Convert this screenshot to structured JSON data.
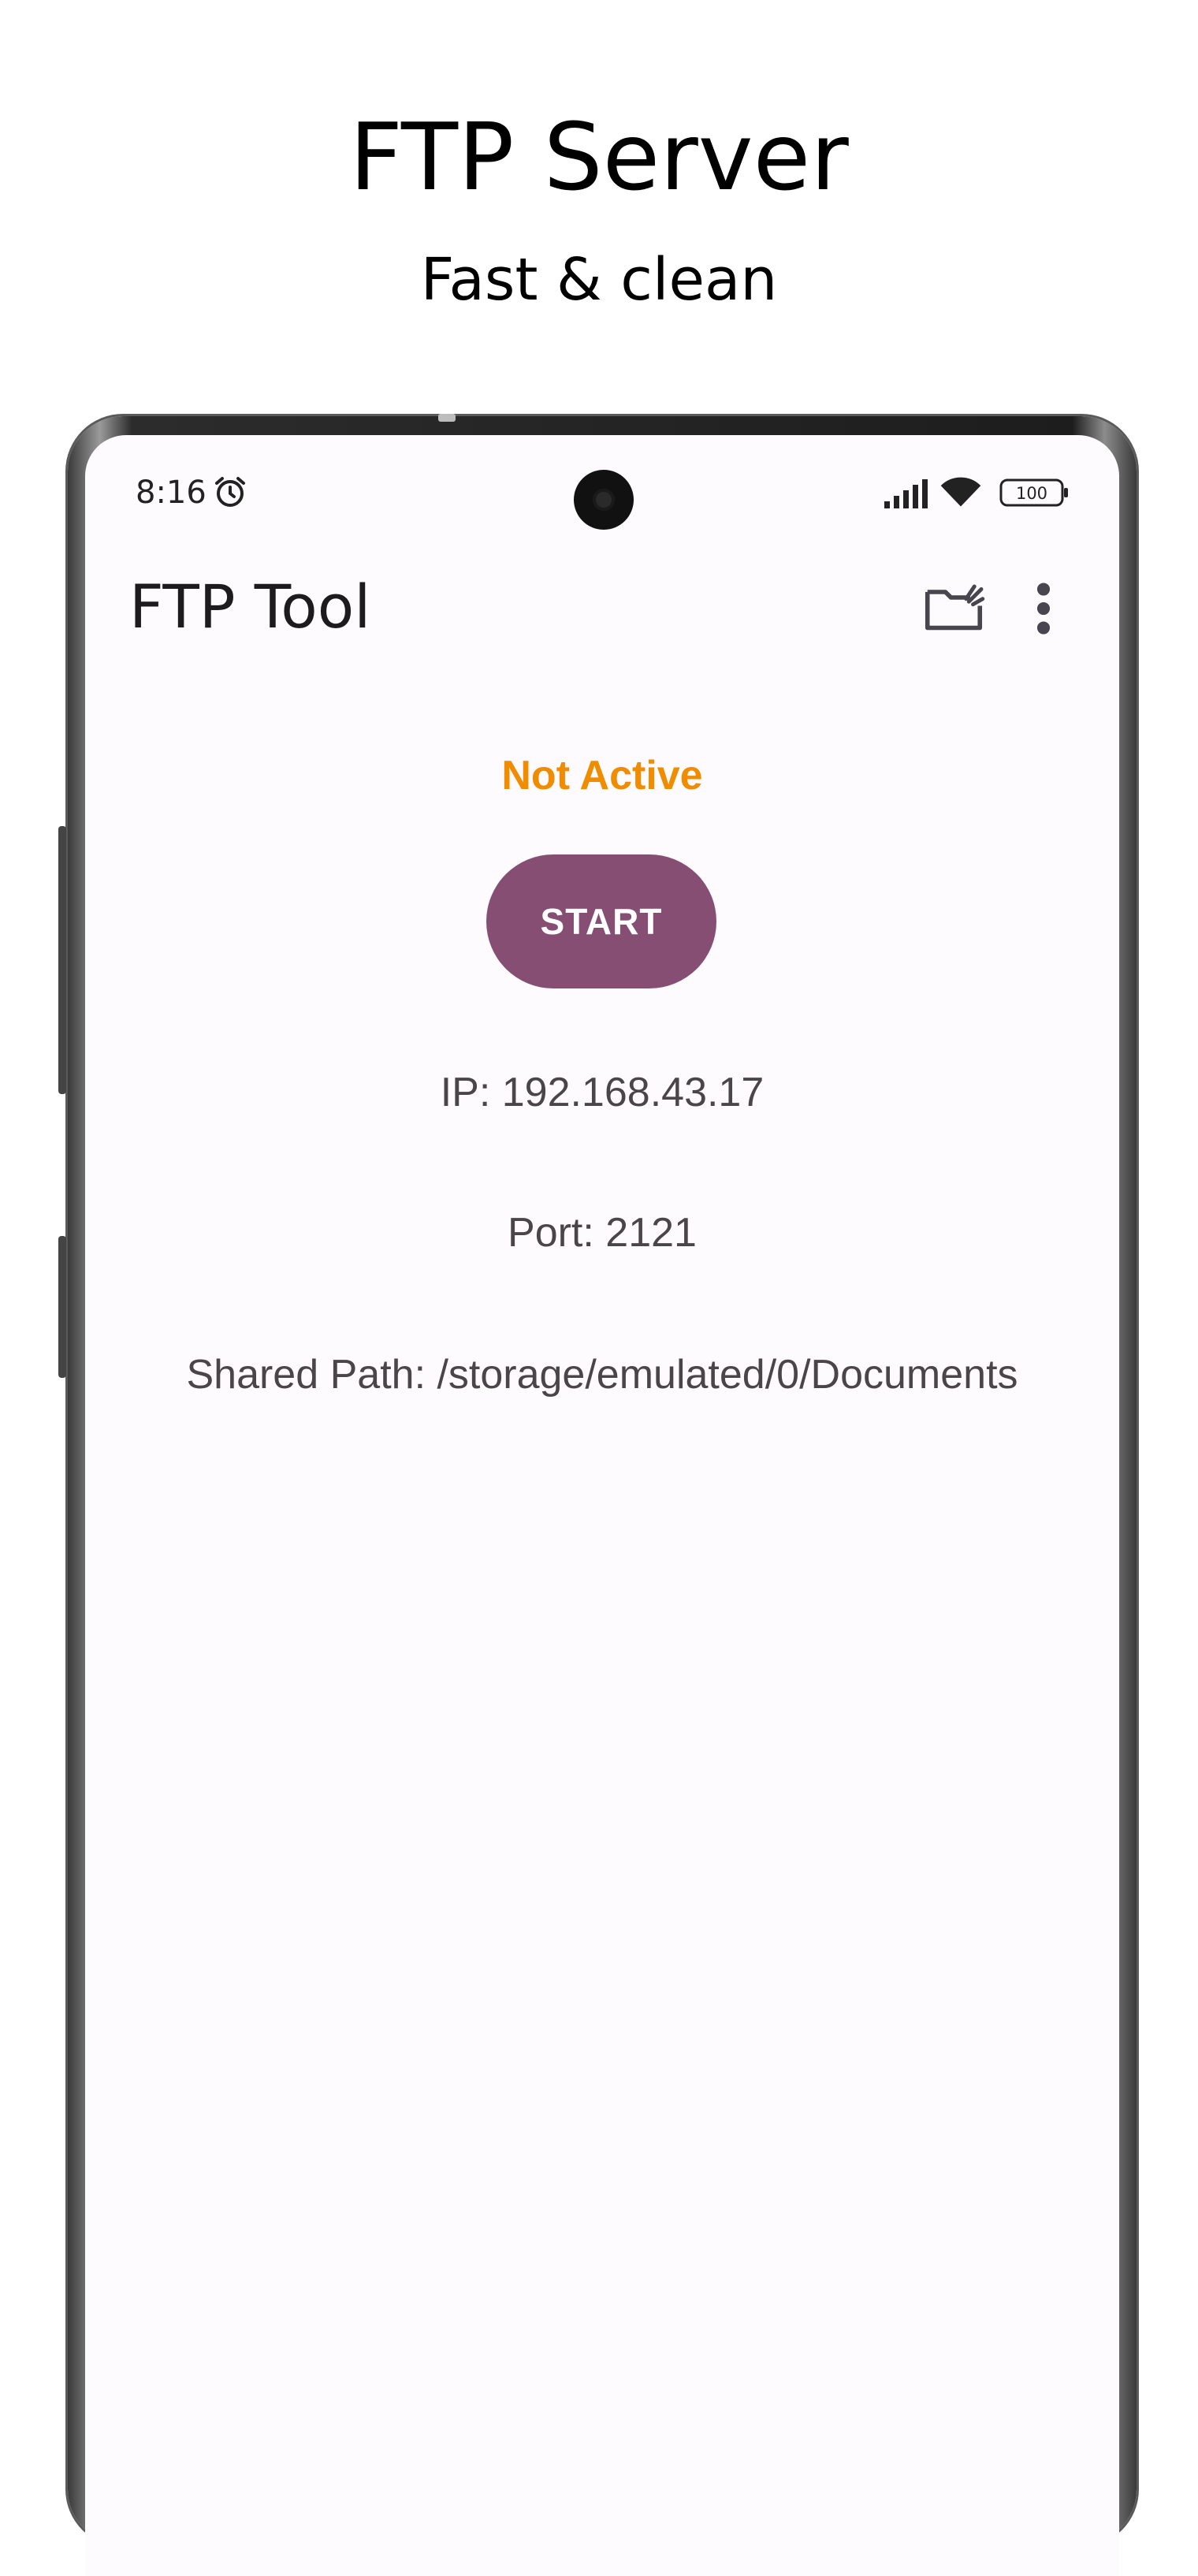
{
  "promo": {
    "title": "FTP Server",
    "subtitle": "Fast & clean"
  },
  "status_bar": {
    "time": "8:16",
    "battery": "100",
    "icons": [
      "alarm-icon",
      "signal-icon",
      "wifi-icon",
      "battery-icon"
    ]
  },
  "app_bar": {
    "title": "FTP Tool",
    "actions": [
      "folder-clean-icon",
      "more-vert-icon"
    ]
  },
  "server": {
    "status": "Not Active",
    "start_label": "START",
    "ip": "IP: 192.168.43.17",
    "port": "Port: 2121",
    "shared_path": "Shared Path: /storage/emulated/0/Documents"
  },
  "colors": {
    "status_inactive": "#f08c00",
    "primary_button": "#874e73",
    "screen_background": "#fefbfe",
    "text": "#4a4549"
  }
}
